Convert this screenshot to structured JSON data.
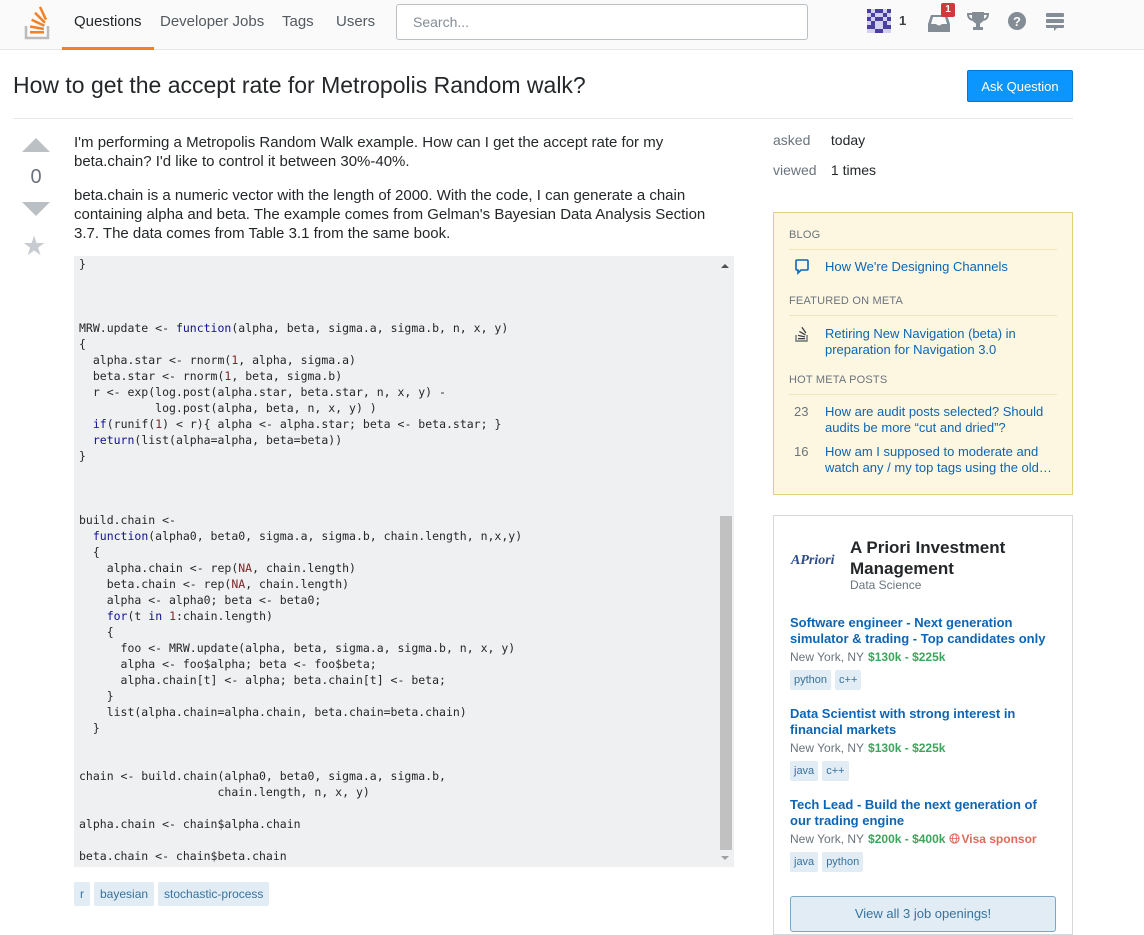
{
  "topbar": {
    "nav": [
      "Questions",
      "Developer Jobs",
      "Tags",
      "Users"
    ],
    "active_nav": "Questions",
    "search_placeholder": "Search...",
    "reputation": "1",
    "inbox_count": "1",
    "icons": [
      "stackoverflow-logo-icon",
      "avatar-identicon",
      "inbox-icon",
      "trophy-icon",
      "help-icon",
      "site-switcher-icon"
    ]
  },
  "question": {
    "title": "How to get the accept rate for Metropolis Random walk?",
    "ask_button": "Ask Question",
    "votes": "0",
    "paragraphs": [
      "I'm performing a Metropolis Random Walk example. How can I get the accept rate for my beta.chain? I'd like to control it between 30%-40%.",
      "beta.chain is a numeric vector with the length of 2000. With the code, I can generate a chain containing alpha and beta. The example comes from Gelman's Bayesian Data Analysis Section 3.7. The data comes from Table 3.1 from the same book."
    ],
    "code_lines": [
      "}",
      "",
      "",
      "",
      "MRW.update <- function(alpha, beta, sigma.a, sigma.b, n, x, y)",
      "{",
      "  alpha.star <- rnorm(1, alpha, sigma.a)",
      "  beta.star <- rnorm(1, beta, sigma.b)",
      "  r <- exp(log.post(alpha.star, beta.star, n, x, y) -",
      "           log.post(alpha, beta, n, x, y) )",
      "  if(runif(1) < r){ alpha <- alpha.star; beta <- beta.star; }",
      "  return(list(alpha=alpha, beta=beta))",
      "}",
      "",
      "",
      "",
      "build.chain <-",
      "  function(alpha0, beta0, sigma.a, sigma.b, chain.length, n,x,y)",
      "  {",
      "    alpha.chain <- rep(NA, chain.length)",
      "    beta.chain <- rep(NA, chain.length)",
      "    alpha <- alpha0; beta <- beta0;",
      "    for(t in 1:chain.length)",
      "    {",
      "      foo <- MRW.update(alpha, beta, sigma.a, sigma.b, n, x, y)",
      "      alpha <- foo$alpha; beta <- foo$beta;",
      "      alpha.chain[t] <- alpha; beta.chain[t] <- beta;",
      "    }",
      "    list(alpha.chain=alpha.chain, beta.chain=beta.chain)",
      "  }",
      "",
      "",
      "chain <- build.chain(alpha0, beta0, sigma.a, sigma.b,",
      "                    chain.length, n, x, y)",
      "",
      "alpha.chain <- chain$alpha.chain",
      "",
      "beta.chain <- chain$beta.chain"
    ],
    "tags": [
      "r",
      "bayesian",
      "stochastic-process"
    ]
  },
  "sidebar": {
    "asked_label": "asked",
    "asked_value": "today",
    "viewed_label": "viewed",
    "viewed_value": "1 times",
    "blog": {
      "blog_heading": "BLOG",
      "blog_item": "How We're Designing Channels",
      "featured_heading": "FEATURED ON META",
      "featured_item": "Retiring New Navigation (beta) in preparation for Navigation 3.0",
      "hot_heading": "HOT META POSTS",
      "hot_items": [
        {
          "count": "23",
          "title": "How are audit posts selected? Should audits be more “cut and dried”?"
        },
        {
          "count": "16",
          "title": "How am I supposed to moderate and watch any / my top tags using the old…"
        }
      ]
    },
    "jobs": {
      "company_logo": "APriori",
      "company": "A Priori Investment Management",
      "company_sub": "Data Science",
      "listings": [
        {
          "title": "Software engineer - Next generation simulator & trading - Top candidates only",
          "location": "New York, NY",
          "salary": "$130k - $225k",
          "visa": "",
          "tags": [
            "python",
            "c++"
          ]
        },
        {
          "title": "Data Scientist with strong interest in financial markets",
          "location": "New York, NY",
          "salary": "$130k - $225k",
          "visa": "",
          "tags": [
            "java",
            "c++"
          ]
        },
        {
          "title": "Tech Lead - Build the next generation of our trading engine",
          "location": "New York, NY",
          "salary": "$200k - $400k",
          "visa": "Visa sponsor",
          "tags": [
            "java",
            "python"
          ]
        }
      ],
      "view_all": "View all 3 job openings!"
    }
  }
}
